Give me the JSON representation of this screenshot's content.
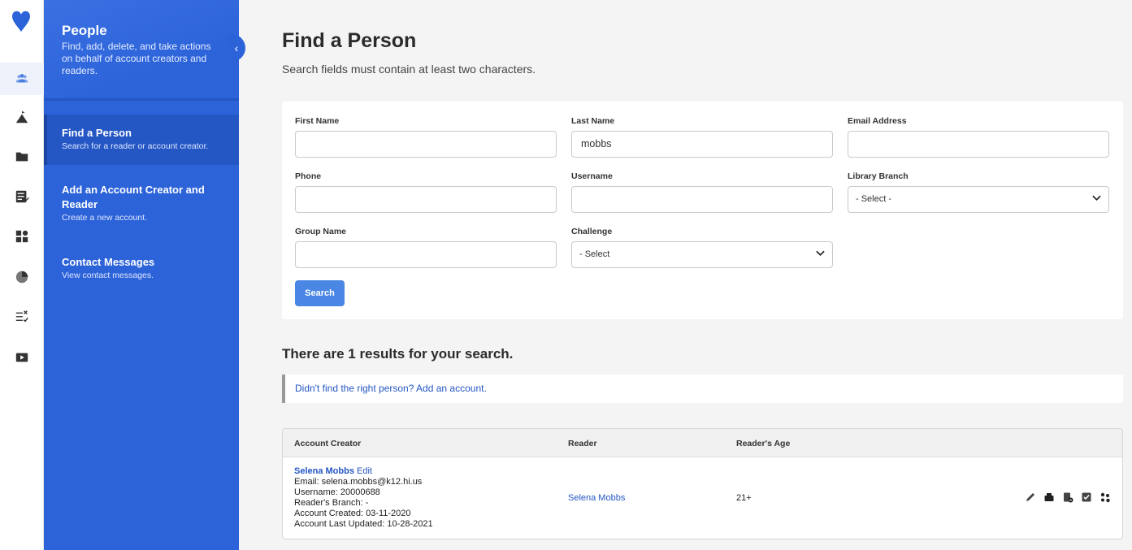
{
  "sidebar": {
    "title": "People",
    "description": "Find, add, delete, and take actions on behalf of account creators and readers.",
    "items": [
      {
        "label": "Find a Person",
        "sub": "Search for a reader or account creator."
      },
      {
        "label": "Add an Account Creator and Reader",
        "sub": "Create a new account."
      },
      {
        "label": "Contact Messages",
        "sub": "View contact messages."
      }
    ]
  },
  "page": {
    "title": "Find a Person",
    "subtitle": "Search fields must contain at least two characters."
  },
  "form": {
    "first_name": {
      "label": "First Name",
      "value": ""
    },
    "last_name": {
      "label": "Last Name",
      "value": "mobbs"
    },
    "email": {
      "label": "Email Address",
      "value": ""
    },
    "phone": {
      "label": "Phone",
      "value": ""
    },
    "username": {
      "label": "Username",
      "value": ""
    },
    "library_branch": {
      "label": "Library Branch",
      "value": "- Select -"
    },
    "group_name": {
      "label": "Group Name",
      "value": ""
    },
    "challenge": {
      "label": "Challenge",
      "value": "- Select"
    },
    "search_label": "Search"
  },
  "results": {
    "count_text": "There are 1 results for your search.",
    "add_link": "Didn't find the right person? Add an account.",
    "columns": [
      "Account Creator",
      "Reader",
      "Reader's Age"
    ],
    "rows": [
      {
        "creator_name": "Selena Mobbs",
        "edit_label": "Edit",
        "email_label": "Email:",
        "email": "selena.mobbs@k12.hi.us",
        "username_label": "Username:",
        "username": "20000688",
        "branch_label": "Reader's Branch:",
        "branch": "-",
        "created_label": "Account Created:",
        "created": "03-11-2020",
        "updated_label": "Account Last Updated:",
        "updated": "10-28-2021",
        "reader": "Selena Mobbs",
        "age": "21+"
      }
    ]
  },
  "colors": {
    "brand": "#2c63d9",
    "link": "#2456c4",
    "button": "#4a86e4"
  }
}
